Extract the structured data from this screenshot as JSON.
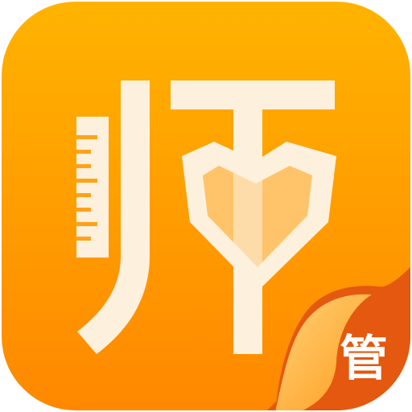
{
  "app_icon": {
    "logo_glyph": "师",
    "badge_label": "管",
    "colors": {
      "background_top": "#FFB300",
      "background_bottom": "#FF8A00",
      "glyph_cream": "#FDF0DC",
      "heart_inner": "#FFC46A",
      "curl_light": "#FFB84A",
      "curl_dark": "#E55A10"
    },
    "icons": [
      "ruler-icon",
      "heart-shield-icon",
      "page-curl-icon"
    ]
  }
}
